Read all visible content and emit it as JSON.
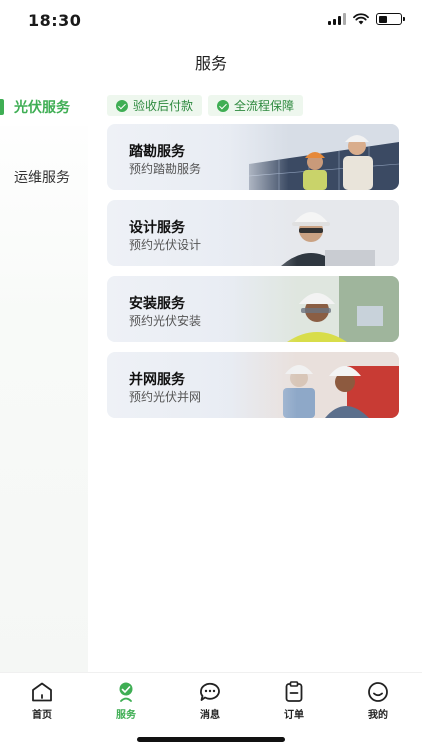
{
  "status_bar": {
    "time": "18:30",
    "battery_percent": 40
  },
  "nav": {
    "title": "服务"
  },
  "sidebar": {
    "items": [
      {
        "label": "光伏服务",
        "active": true
      },
      {
        "label": "运维服务",
        "active": false
      }
    ]
  },
  "badges": [
    {
      "label": "验收后付款",
      "icon": "check-circle-icon"
    },
    {
      "label": "全流程保障",
      "icon": "check-circle-icon"
    }
  ],
  "services": [
    {
      "title": "踏勘服务",
      "subtitle": "预约踏勘服务",
      "image": "engineers-solar-panels-photo"
    },
    {
      "title": "设计服务",
      "subtitle": "预约光伏设计",
      "image": "engineer-hardhat-laptop-photo"
    },
    {
      "title": "安装服务",
      "subtitle": "预约光伏安装",
      "image": "installer-safety-glasses-photo"
    },
    {
      "title": "并网服务",
      "subtitle": "预约光伏并网",
      "image": "grid-technicians-photo"
    }
  ],
  "tabbar": {
    "items": [
      {
        "label": "首页",
        "icon": "home-icon",
        "active": false
      },
      {
        "label": "服务",
        "icon": "service-icon",
        "active": true
      },
      {
        "label": "消息",
        "icon": "message-icon",
        "active": false
      },
      {
        "label": "订单",
        "icon": "order-icon",
        "active": false
      },
      {
        "label": "我的",
        "icon": "profile-icon",
        "active": false
      }
    ]
  },
  "colors": {
    "accent": "#3fae54",
    "badge_bg": "#eef7ee",
    "card_bg": "#eef1f6"
  }
}
